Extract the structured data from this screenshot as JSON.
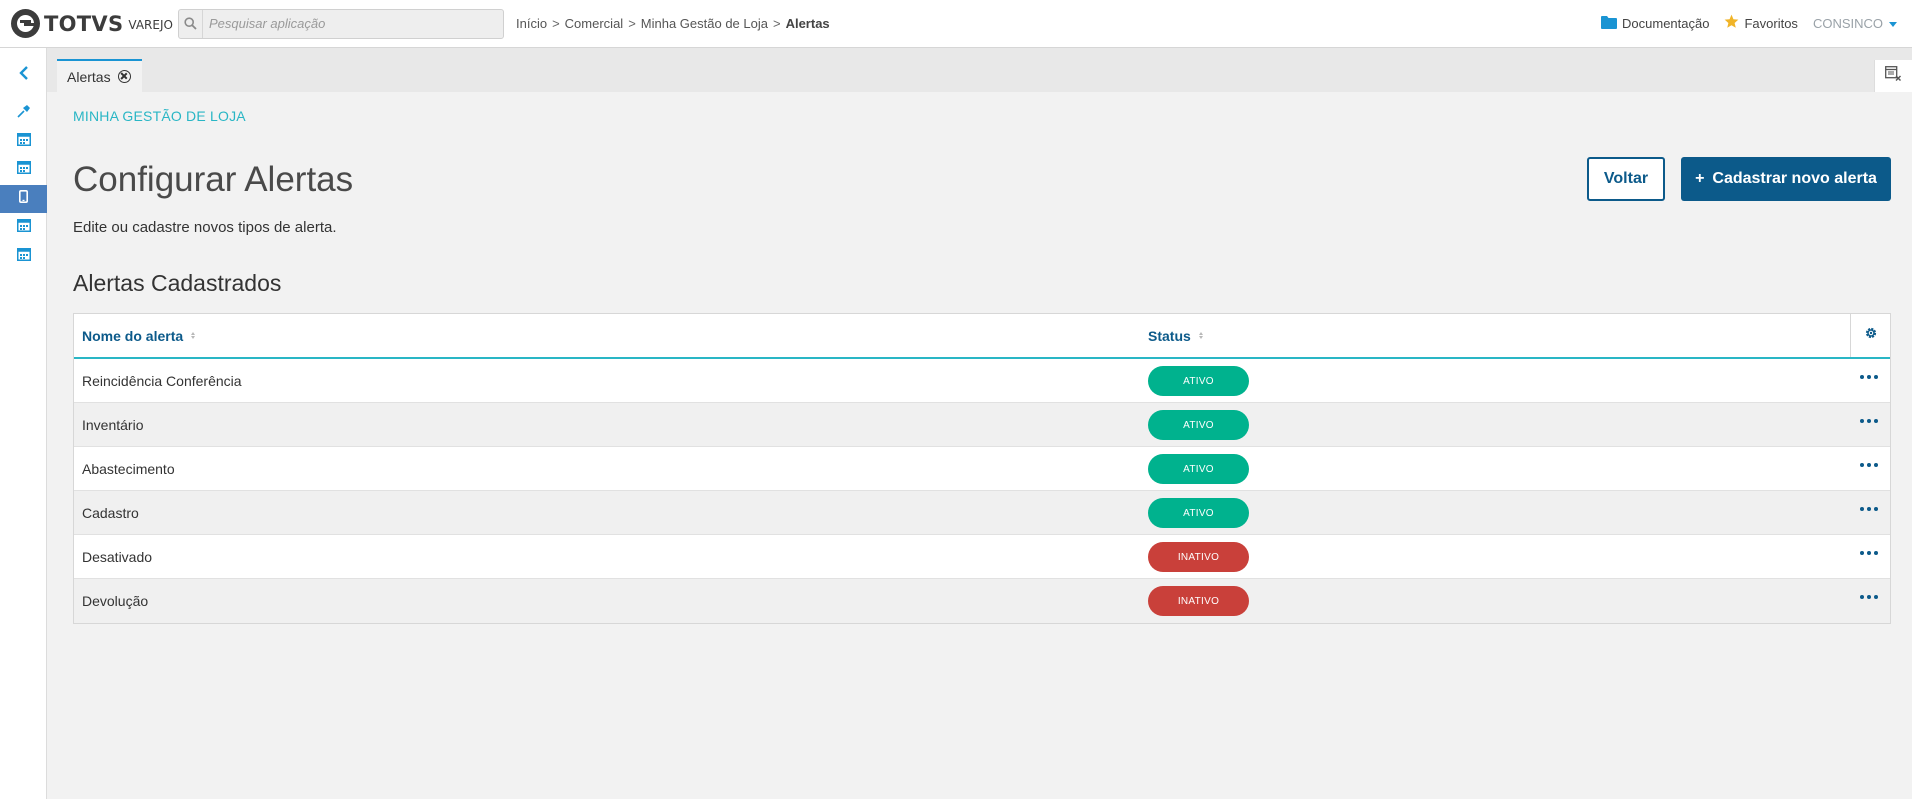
{
  "header": {
    "logo_text": "TOTVS",
    "logo_sub": "VAREJO",
    "search_placeholder": "Pesquisar aplicação",
    "breadcrumb": [
      "Início",
      "Comercial",
      "Minha Gestão de Loja",
      "Alertas"
    ],
    "documentation_label": "Documentação",
    "favorites_label": "Favoritos",
    "user": "CONSINCO"
  },
  "sidebar": {
    "items": [
      {
        "icon": "chevron-left-icon",
        "active": false
      },
      {
        "icon": "pin-icon",
        "active": false
      },
      {
        "icon": "calendar-grid-icon",
        "active": false
      },
      {
        "icon": "calendar-grid-icon",
        "active": false
      },
      {
        "icon": "mobile-icon",
        "active": true
      },
      {
        "icon": "calendar-grid-icon",
        "active": false
      },
      {
        "icon": "calendar-grid-icon",
        "active": false
      }
    ]
  },
  "tabs": [
    {
      "label": "Alertas"
    }
  ],
  "main": {
    "section_label": "MINHA GESTÃO DE LOJA",
    "title": "Configurar Alertas",
    "subtitle": "Edite ou cadastre novos tipos de alerta.",
    "back_label": "Voltar",
    "new_label": "Cadastrar novo alerta",
    "new_prefix": "+",
    "table_title": "Alertas Cadastrados"
  },
  "table": {
    "columns": [
      "Nome do alerta",
      "Status"
    ],
    "rows": [
      {
        "name": "Reincidência Conferência",
        "status": "ATIVO"
      },
      {
        "name": "Inventário",
        "status": "ATIVO"
      },
      {
        "name": "Abastecimento",
        "status": "ATIVO"
      },
      {
        "name": "Cadastro",
        "status": "ATIVO"
      },
      {
        "name": "Desativado",
        "status": "INATIVO"
      },
      {
        "name": "Devolução",
        "status": "INATIVO"
      }
    ]
  },
  "colors": {
    "primary": "#0c5a8a",
    "accent": "#29b6c5",
    "link_blue": "#1a94d3",
    "active_badge": "#00b28e",
    "inactive_badge": "#c9403a",
    "sidebar_active": "#4a7fbe",
    "star": "#f0b429"
  }
}
